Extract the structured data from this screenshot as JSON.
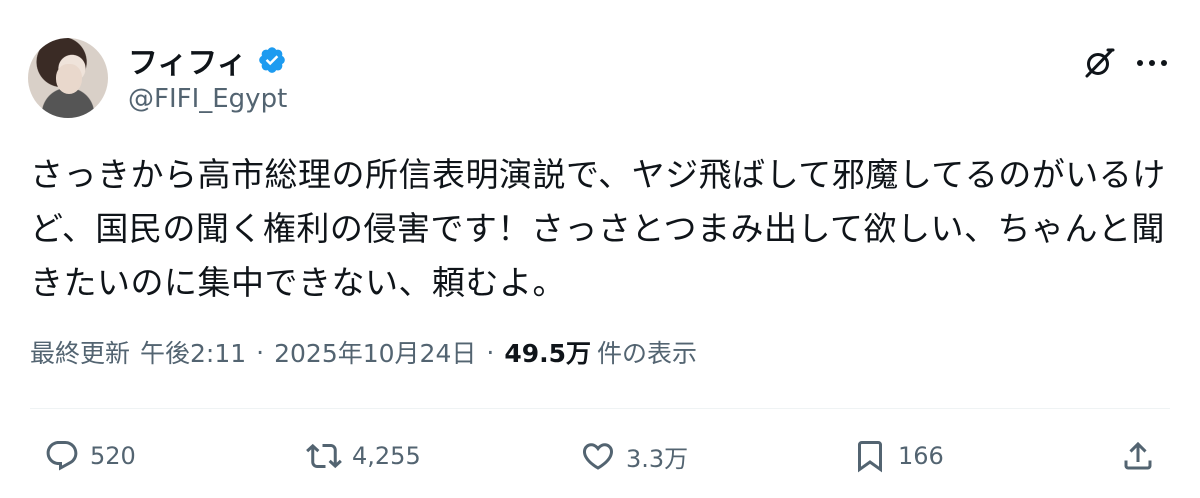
{
  "author": {
    "display_name": "フィフィ",
    "handle": "@FIFI_Egypt",
    "verified": true
  },
  "tweet": {
    "text": "さっきから高市総理の所信表明演説で、ヤジ飛ばして邪魔してるのがいるけど、国民の聞く権利の侵害です！さっさとつまみ出して欲しい、ちゃんと聞きたいのに集中できない、頼むよ。",
    "updated_label": "最終更新",
    "time": "午後2:11",
    "date": "2025年10月24日",
    "views": "49.5万",
    "views_label": "件の表示"
  },
  "actions": {
    "replies": "520",
    "reposts": "4,255",
    "likes": "3.3万",
    "bookmarks": "166"
  },
  "colors": {
    "text": "#0f1419",
    "secondary": "#536471",
    "verified": "#1d9bf0"
  },
  "icons": [
    "verified-badge-icon",
    "grok-icon",
    "more-icon",
    "reply-icon",
    "repost-icon",
    "like-icon",
    "bookmark-icon",
    "share-icon"
  ]
}
